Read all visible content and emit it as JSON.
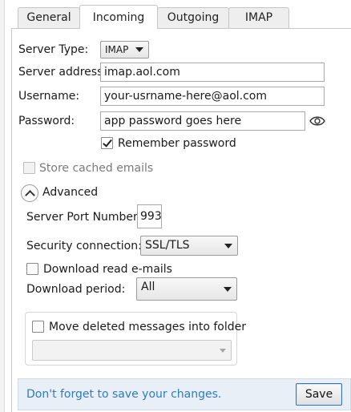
{
  "tabs": [
    {
      "label": "General",
      "active": false
    },
    {
      "label": "Incoming",
      "active": true
    },
    {
      "label": "Outgoing",
      "active": false
    },
    {
      "label": "IMAP",
      "active": false
    }
  ],
  "server_type": {
    "label": "Server Type:",
    "value": "IMAP"
  },
  "server_address": {
    "label": "Server address:",
    "value": "imap.aol.com"
  },
  "username": {
    "label": "Username:",
    "value": "your-usrname-here@aol.com"
  },
  "password": {
    "label": "Password:",
    "value": "app password goes here",
    "reveal_icon": "eye-icon"
  },
  "remember_password": {
    "label": "Remember password",
    "checked": true
  },
  "store_cached": {
    "label": "Store cached emails",
    "checked": false,
    "enabled": false
  },
  "advanced": {
    "label": "Advanced",
    "expanded": true,
    "icon": "chevron-up-icon"
  },
  "port": {
    "label": "Server Port Number:",
    "value": "993"
  },
  "security": {
    "label": "Security connection:",
    "value": "SSL/TLS"
  },
  "download_read": {
    "label": "Download read e-mails",
    "checked": false
  },
  "download_period": {
    "label": "Download period:",
    "value": "All"
  },
  "move_deleted": {
    "label": "Move deleted messages into folder",
    "checked": false,
    "folder_value": ""
  },
  "footer": {
    "message": "Don't forget to save your changes.",
    "save_label": "Save"
  },
  "colors": {
    "footer_text": "#2f7bbf",
    "footer_bg": "#e9eff7",
    "button_border": "#3b72b0"
  }
}
